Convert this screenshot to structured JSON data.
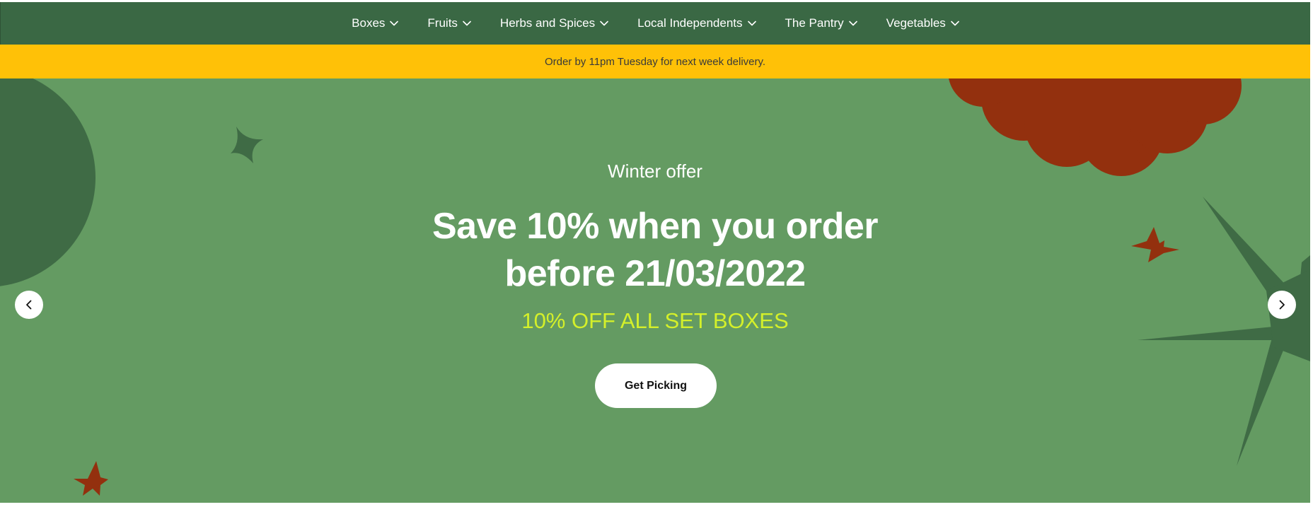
{
  "nav": {
    "items": [
      {
        "label": "Boxes"
      },
      {
        "label": "Fruits"
      },
      {
        "label": "Herbs and Spices"
      },
      {
        "label": "Local Independents"
      },
      {
        "label": "The Pantry"
      },
      {
        "label": "Vegetables"
      }
    ]
  },
  "banner": {
    "text": "Order by 11pm Tuesday for next week delivery."
  },
  "hero": {
    "eyebrow": "Winter offer",
    "headline_line1": "Save 10% when you order",
    "headline_line2": "before 21/03/2022",
    "subhead": "10% OFF ALL SET BOXES",
    "cta_label": "Get Picking",
    "prev_icon": "chevron-left-icon",
    "next_icon": "chevron-right-icon"
  },
  "colors": {
    "nav_bg": "#3a6844",
    "banner_bg": "#ffc107",
    "hero_bg": "#649b62",
    "accent_text": "#d4f02a",
    "deco_dark_green": "#3f6b45",
    "deco_rust": "#93300e"
  }
}
